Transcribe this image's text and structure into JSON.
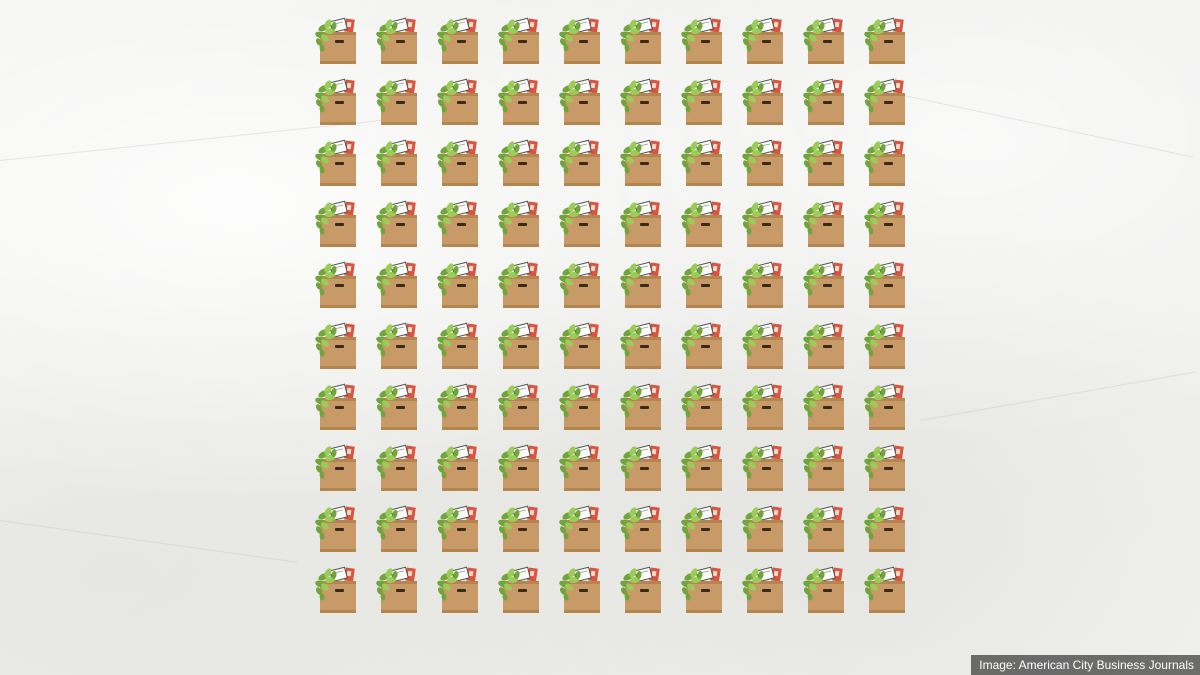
{
  "image_credit": "Image: American City Business Journals",
  "grid": {
    "rows": 10,
    "columns": 10,
    "item_icon": "office-box-with-plant-icon"
  },
  "colors": {
    "box": "#c79a67",
    "box_shadow": "#b4864f",
    "plant": "#6fa53a",
    "plant_light": "#9ccc58",
    "frame_red": "#d9553f"
  }
}
